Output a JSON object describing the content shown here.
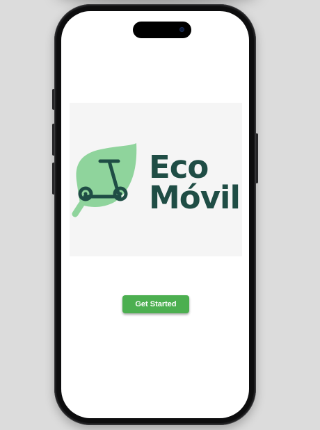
{
  "logo": {
    "line1": "Eco",
    "line2": "Móvil",
    "icon": "leaf-scooter-icon",
    "leaf_color": "#8fd49c",
    "scooter_color": "#1f4d45",
    "text_color": "#1f4d45"
  },
  "main": {
    "cta_label": "Get Started",
    "cta_color": "#4caf50"
  }
}
